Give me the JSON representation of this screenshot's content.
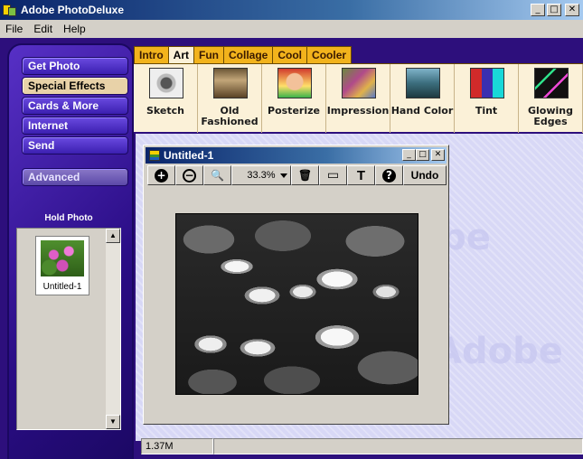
{
  "app": {
    "title": "Adobe PhotoDeluxe"
  },
  "menu": [
    "File",
    "Edit",
    "Help"
  ],
  "window_controls": {
    "minimize": "_",
    "maximize": "□",
    "close": "✕"
  },
  "sidebar": {
    "nav": [
      {
        "label": "Get Photo",
        "active": false
      },
      {
        "label": "Special Effects",
        "active": true
      },
      {
        "label": "Cards & More",
        "active": false
      },
      {
        "label": "Internet",
        "active": false
      },
      {
        "label": "Send",
        "active": false
      }
    ],
    "advanced_label": "Advanced",
    "hold_photo": {
      "title": "Hold Photo",
      "items": [
        {
          "label": "Untitled-1"
        }
      ]
    }
  },
  "tabs": [
    {
      "label": "Intro",
      "active": false
    },
    {
      "label": "Art",
      "active": true
    },
    {
      "label": "Fun",
      "active": false
    },
    {
      "label": "Collage",
      "active": false
    },
    {
      "label": "Cool",
      "active": false
    },
    {
      "label": "Cooler",
      "active": false
    }
  ],
  "effects": [
    {
      "label": "Sketch",
      "thumb": "t-sketch"
    },
    {
      "label": "Old Fashioned",
      "thumb": "t-old"
    },
    {
      "label": "Posterize",
      "thumb": "t-post"
    },
    {
      "label": "Impression",
      "thumb": "t-imp"
    },
    {
      "label": "Hand Color",
      "thumb": "t-hand"
    },
    {
      "label": "Tint",
      "thumb": "t-tint"
    },
    {
      "label": "Glowing Edges",
      "thumb": "t-glow"
    }
  ],
  "watermark": "Adobe",
  "document": {
    "title": "Untitled-1",
    "zoom": "33.3%",
    "toolbar": {
      "zoom_in_glyph": "+",
      "zoom_out_glyph": "−",
      "magnify_glyph": "🔍",
      "trash_glyph": "🗑",
      "frame_glyph": "▭",
      "text_glyph": "T",
      "help_glyph": "?",
      "undo_label": "Undo"
    }
  },
  "status": {
    "memory": "1.37M"
  },
  "colors": {
    "workspace": "#2d0f7c",
    "tab": "#f2b31c",
    "effects_bg": "#fbf1d8",
    "titlebar": "#0a246a"
  }
}
